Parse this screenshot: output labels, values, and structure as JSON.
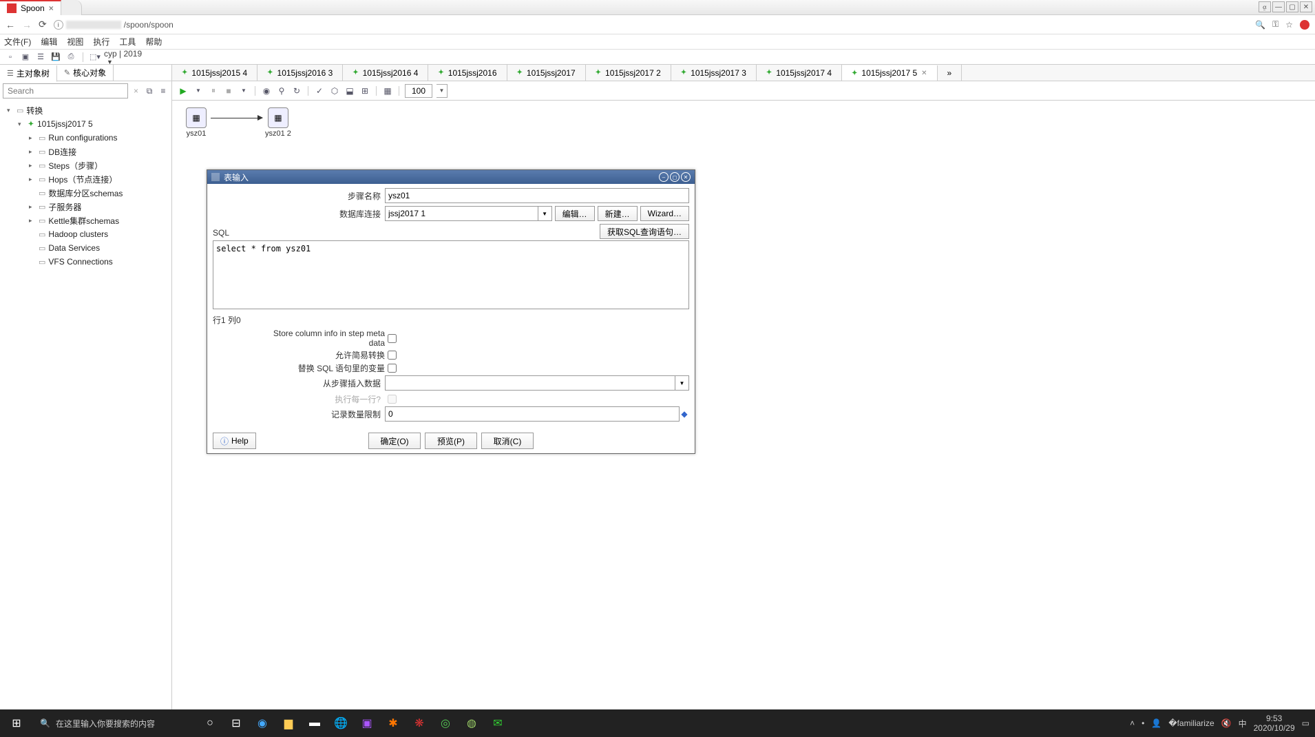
{
  "titlebar": {
    "tab_title": "Spoon",
    "close": "×"
  },
  "urlbar": {
    "path": "/spoon/spoon"
  },
  "menubar": {
    "file": "文件(F)",
    "edit": "编辑",
    "view": "视图",
    "run": "执行",
    "tools": "工具",
    "help": "帮助"
  },
  "app_right": "cyp | 2019",
  "left_tabs": {
    "main": "主对象树",
    "core": "核心对象"
  },
  "search": {
    "placeholder": "Search"
  },
  "tree": {
    "root": "转换",
    "trans": "1015jssj2017 5",
    "nodes": {
      "run_conf": "Run configurations",
      "db": "DB连接",
      "steps": "Steps（步骤）",
      "hops": "Hops（节点连接）",
      "partition": "数据库分区schemas",
      "slave": "子服务器",
      "cluster": "Kettle集群schemas",
      "hadoop": "Hadoop clusters",
      "data_services": "Data Services",
      "vfs": "VFS Connections"
    }
  },
  "editor_tabs": [
    "1015jssj2015 4",
    "1015jssj2016 3",
    "1015jssj2016 4",
    "1015jssj2016",
    "1015jssj2017",
    "1015jssj2017 2",
    "1015jssj2017 3",
    "1015jssj2017 4",
    "1015jssj2017 5"
  ],
  "runbar": {
    "zoom": "100"
  },
  "canvas": {
    "step1": "ysz01",
    "step2": "ysz01 2"
  },
  "dialog": {
    "title": "表输入",
    "step_name_label": "步骤名称",
    "step_name": "ysz01",
    "db_label": "数据库连接",
    "db_value": "jssj2017 1",
    "btn_edit": "编辑…",
    "btn_new": "新建…",
    "btn_wizard": "Wizard…",
    "sql_label": "SQL",
    "btn_get_sql": "获取SQL查询语句…",
    "sql_text": "select * from ysz01",
    "status": "行1 列0",
    "chk_store": "Store column info in step meta data",
    "chk_lazy": "允许简易转换",
    "chk_vars": "替换 SQL 语句里的变量",
    "insert_label": "从步骤插入数据",
    "eachrow_label": "执行每一行?",
    "limit_label": "记录数量限制",
    "limit_value": "0",
    "btn_help": "Help",
    "btn_ok": "确定(O)",
    "btn_preview": "预览(P)",
    "btn_cancel": "取消(C)"
  },
  "taskbar": {
    "search": "在这里输入你要搜索的内容",
    "time": "9:53",
    "date": "2020/10/29",
    "ime": "中"
  }
}
